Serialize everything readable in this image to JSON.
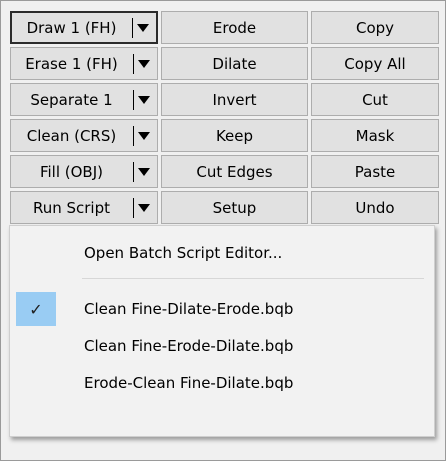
{
  "buttons": {
    "col1": [
      "Draw 1 (FH)",
      "Erase 1 (FH)",
      "Separate 1",
      "Clean (CRS)",
      "Fill (OBJ)",
      "Run Script"
    ],
    "col2": [
      "Erode",
      "Dilate",
      "Invert",
      "Keep",
      "Cut Edges",
      "Setup"
    ],
    "col3": [
      "Copy",
      "Copy All",
      "Cut",
      "Mask",
      "Paste",
      "Undo"
    ]
  },
  "dropdown_arrow_icon": "triangle-down",
  "menu": {
    "open_editor": "Open Batch Script Editor...",
    "scripts": [
      "Clean Fine-Dilate-Erode.bqb",
      "Clean Fine-Erode-Dilate.bqb",
      "Erode-Clean Fine-Dilate.bqb"
    ],
    "checked_index": 0,
    "checkmark": "✓"
  },
  "colors": {
    "check_highlight": "#99ccf3",
    "button_bg": "#e1e1e1"
  }
}
